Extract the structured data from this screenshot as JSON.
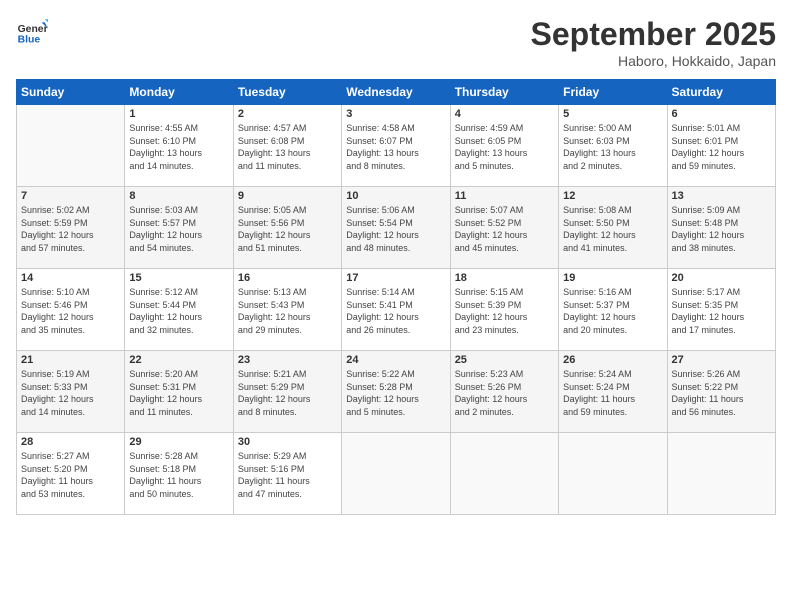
{
  "logo": {
    "text_general": "General",
    "text_blue": "Blue"
  },
  "header": {
    "month": "September 2025",
    "location": "Haboro, Hokkaido, Japan"
  },
  "weekdays": [
    "Sunday",
    "Monday",
    "Tuesday",
    "Wednesday",
    "Thursday",
    "Friday",
    "Saturday"
  ],
  "weeks": [
    [
      {
        "day": "",
        "info": ""
      },
      {
        "day": "1",
        "info": "Sunrise: 4:55 AM\nSunset: 6:10 PM\nDaylight: 13 hours\nand 14 minutes."
      },
      {
        "day": "2",
        "info": "Sunrise: 4:57 AM\nSunset: 6:08 PM\nDaylight: 13 hours\nand 11 minutes."
      },
      {
        "day": "3",
        "info": "Sunrise: 4:58 AM\nSunset: 6:07 PM\nDaylight: 13 hours\nand 8 minutes."
      },
      {
        "day": "4",
        "info": "Sunrise: 4:59 AM\nSunset: 6:05 PM\nDaylight: 13 hours\nand 5 minutes."
      },
      {
        "day": "5",
        "info": "Sunrise: 5:00 AM\nSunset: 6:03 PM\nDaylight: 13 hours\nand 2 minutes."
      },
      {
        "day": "6",
        "info": "Sunrise: 5:01 AM\nSunset: 6:01 PM\nDaylight: 12 hours\nand 59 minutes."
      }
    ],
    [
      {
        "day": "7",
        "info": "Sunrise: 5:02 AM\nSunset: 5:59 PM\nDaylight: 12 hours\nand 57 minutes."
      },
      {
        "day": "8",
        "info": "Sunrise: 5:03 AM\nSunset: 5:57 PM\nDaylight: 12 hours\nand 54 minutes."
      },
      {
        "day": "9",
        "info": "Sunrise: 5:05 AM\nSunset: 5:56 PM\nDaylight: 12 hours\nand 51 minutes."
      },
      {
        "day": "10",
        "info": "Sunrise: 5:06 AM\nSunset: 5:54 PM\nDaylight: 12 hours\nand 48 minutes."
      },
      {
        "day": "11",
        "info": "Sunrise: 5:07 AM\nSunset: 5:52 PM\nDaylight: 12 hours\nand 45 minutes."
      },
      {
        "day": "12",
        "info": "Sunrise: 5:08 AM\nSunset: 5:50 PM\nDaylight: 12 hours\nand 41 minutes."
      },
      {
        "day": "13",
        "info": "Sunrise: 5:09 AM\nSunset: 5:48 PM\nDaylight: 12 hours\nand 38 minutes."
      }
    ],
    [
      {
        "day": "14",
        "info": "Sunrise: 5:10 AM\nSunset: 5:46 PM\nDaylight: 12 hours\nand 35 minutes."
      },
      {
        "day": "15",
        "info": "Sunrise: 5:12 AM\nSunset: 5:44 PM\nDaylight: 12 hours\nand 32 minutes."
      },
      {
        "day": "16",
        "info": "Sunrise: 5:13 AM\nSunset: 5:43 PM\nDaylight: 12 hours\nand 29 minutes."
      },
      {
        "day": "17",
        "info": "Sunrise: 5:14 AM\nSunset: 5:41 PM\nDaylight: 12 hours\nand 26 minutes."
      },
      {
        "day": "18",
        "info": "Sunrise: 5:15 AM\nSunset: 5:39 PM\nDaylight: 12 hours\nand 23 minutes."
      },
      {
        "day": "19",
        "info": "Sunrise: 5:16 AM\nSunset: 5:37 PM\nDaylight: 12 hours\nand 20 minutes."
      },
      {
        "day": "20",
        "info": "Sunrise: 5:17 AM\nSunset: 5:35 PM\nDaylight: 12 hours\nand 17 minutes."
      }
    ],
    [
      {
        "day": "21",
        "info": "Sunrise: 5:19 AM\nSunset: 5:33 PM\nDaylight: 12 hours\nand 14 minutes."
      },
      {
        "day": "22",
        "info": "Sunrise: 5:20 AM\nSunset: 5:31 PM\nDaylight: 12 hours\nand 11 minutes."
      },
      {
        "day": "23",
        "info": "Sunrise: 5:21 AM\nSunset: 5:29 PM\nDaylight: 12 hours\nand 8 minutes."
      },
      {
        "day": "24",
        "info": "Sunrise: 5:22 AM\nSunset: 5:28 PM\nDaylight: 12 hours\nand 5 minutes."
      },
      {
        "day": "25",
        "info": "Sunrise: 5:23 AM\nSunset: 5:26 PM\nDaylight: 12 hours\nand 2 minutes."
      },
      {
        "day": "26",
        "info": "Sunrise: 5:24 AM\nSunset: 5:24 PM\nDaylight: 11 hours\nand 59 minutes."
      },
      {
        "day": "27",
        "info": "Sunrise: 5:26 AM\nSunset: 5:22 PM\nDaylight: 11 hours\nand 56 minutes."
      }
    ],
    [
      {
        "day": "28",
        "info": "Sunrise: 5:27 AM\nSunset: 5:20 PM\nDaylight: 11 hours\nand 53 minutes."
      },
      {
        "day": "29",
        "info": "Sunrise: 5:28 AM\nSunset: 5:18 PM\nDaylight: 11 hours\nand 50 minutes."
      },
      {
        "day": "30",
        "info": "Sunrise: 5:29 AM\nSunset: 5:16 PM\nDaylight: 11 hours\nand 47 minutes."
      },
      {
        "day": "",
        "info": ""
      },
      {
        "day": "",
        "info": ""
      },
      {
        "day": "",
        "info": ""
      },
      {
        "day": "",
        "info": ""
      }
    ]
  ]
}
